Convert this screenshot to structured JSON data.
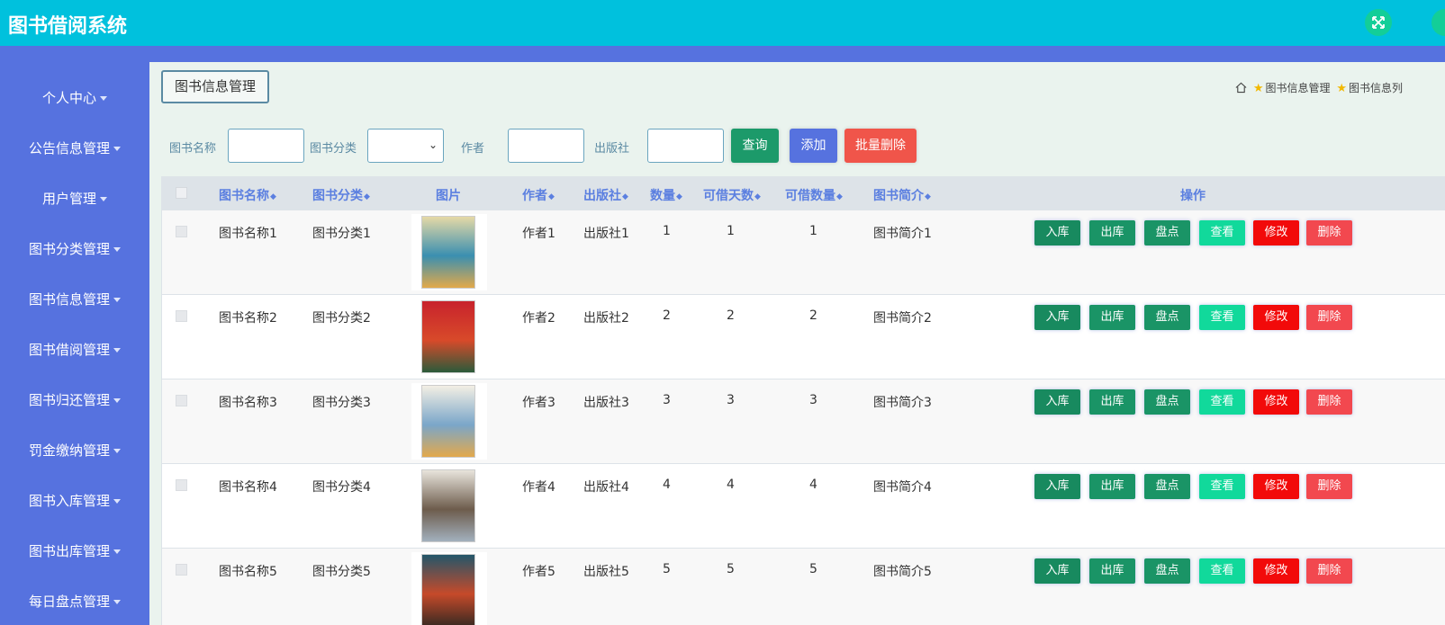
{
  "app": {
    "title": "图书借阅系统",
    "fullscreen_icon": "expand-arrows-icon"
  },
  "sidebar": {
    "items": [
      {
        "label": "个人中心"
      },
      {
        "label": "公告信息管理"
      },
      {
        "label": "用户管理"
      },
      {
        "label": "图书分类管理"
      },
      {
        "label": "图书信息管理"
      },
      {
        "label": "图书借阅管理"
      },
      {
        "label": "图书归还管理"
      },
      {
        "label": "罚金缴纳管理"
      },
      {
        "label": "图书入库管理"
      },
      {
        "label": "图书出库管理"
      },
      {
        "label": "每日盘点管理"
      }
    ]
  },
  "page": {
    "tab_title": "图书信息管理",
    "breadcrumb": [
      "图书信息管理",
      "图书信息列"
    ]
  },
  "search": {
    "name_label": "图书名称",
    "name_value": "",
    "category_label": "图书分类",
    "category_value": "",
    "author_label": "作者",
    "author_value": "",
    "publisher_label": "出版社",
    "publisher_value": "",
    "query_button": "查询",
    "add_button": "添加",
    "batch_delete_button": "批量删除"
  },
  "table": {
    "headers": {
      "name": "图书名称",
      "category": "图书分类",
      "image": "图片",
      "author": "作者",
      "publisher": "出版社",
      "quantity": "数量",
      "days": "可借天数",
      "available": "可借数量",
      "intro": "图书简介",
      "actions": "操作"
    },
    "actions": {
      "in": "入库",
      "out": "出库",
      "check": "盘点",
      "view": "查看",
      "edit": "修改",
      "delete": "删除"
    },
    "rows": [
      {
        "name": "图书名称1",
        "category": "图书分类1",
        "author": "作者1",
        "publisher": "出版社1",
        "quantity": "1",
        "days": "1",
        "available": "1",
        "intro": "图书简介1"
      },
      {
        "name": "图书名称2",
        "category": "图书分类2",
        "author": "作者2",
        "publisher": "出版社2",
        "quantity": "2",
        "days": "2",
        "available": "2",
        "intro": "图书简介2"
      },
      {
        "name": "图书名称3",
        "category": "图书分类3",
        "author": "作者3",
        "publisher": "出版社3",
        "quantity": "3",
        "days": "3",
        "available": "3",
        "intro": "图书简介3"
      },
      {
        "name": "图书名称4",
        "category": "图书分类4",
        "author": "作者4",
        "publisher": "出版社4",
        "quantity": "4",
        "days": "4",
        "available": "4",
        "intro": "图书简介4"
      },
      {
        "name": "图书名称5",
        "category": "图书分类5",
        "author": "作者5",
        "publisher": "出版社5",
        "quantity": "5",
        "days": "5",
        "available": "5",
        "intro": "图书简介5"
      }
    ]
  },
  "colors": {
    "topbar": "#00c1dd",
    "sidebar": "#5672df",
    "query": "#1c9a6a",
    "add": "#5672df",
    "batch_delete": "#f0554a",
    "view": "#11d99b",
    "edit": "#f20a0a",
    "delete": "#f2484f"
  }
}
